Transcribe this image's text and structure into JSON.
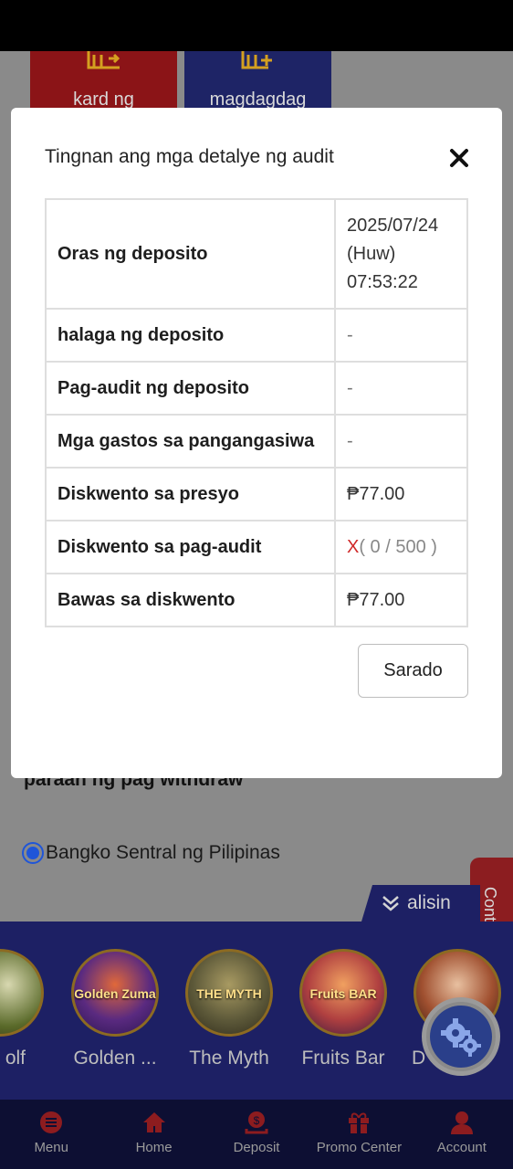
{
  "background": {
    "tiles": [
      {
        "label": "kard ng"
      },
      {
        "label": "magdagdag"
      }
    ],
    "withdraw_method_title": "paraan ng pag withdraw",
    "bank_option": "Bangko Sentral ng Pilipinas",
    "contact_tab": "Cont",
    "hide_tab": "alisin",
    "games": [
      {
        "name": "olf",
        "icon": "golf-game-icon"
      },
      {
        "name": "Golden ...",
        "icon": "golden-zuma-game-icon",
        "art_text": "Golden Zuma"
      },
      {
        "name": "The Myth",
        "icon": "the-myth-game-icon",
        "art_text": "THE MYTH"
      },
      {
        "name": "Fruits Bar",
        "icon": "fruits-bar-game-icon",
        "art_text": "Fruits BAR"
      },
      {
        "name": "D",
        "icon": "dessert-game-icon"
      }
    ]
  },
  "nav": [
    {
      "label": "Menu",
      "icon": "menu-icon"
    },
    {
      "label": "Home",
      "icon": "home-icon"
    },
    {
      "label": "Deposit",
      "icon": "deposit-icon"
    },
    {
      "label": "Promo Center",
      "icon": "gift-icon"
    },
    {
      "label": "Account",
      "icon": "account-icon"
    }
  ],
  "modal": {
    "title": "Tingnan ang mga detalye ng audit",
    "close_button": "Sarado",
    "rows": [
      {
        "label": "Oras ng deposito",
        "value_lines": [
          "2025/07/24",
          "(Huw)",
          "07:53:22"
        ]
      },
      {
        "label": "halaga ng deposito",
        "value": "-"
      },
      {
        "label": "Pag-audit ng deposito",
        "value": "-"
      },
      {
        "label": "Mga gastos sa pangangasiwa",
        "value": "-"
      },
      {
        "label": "Diskwento sa presyo",
        "value": "₱77.00"
      },
      {
        "label": "Diskwento sa pag-audit",
        "status": "X",
        "progress": "( 0 / 500 )"
      },
      {
        "label": "Bawas sa diskwento",
        "value": "₱77.00"
      }
    ]
  },
  "colors": {
    "accent_red": "#d02828",
    "nav_bg": "#0d0f33",
    "strip_bg": "#1d2064"
  }
}
